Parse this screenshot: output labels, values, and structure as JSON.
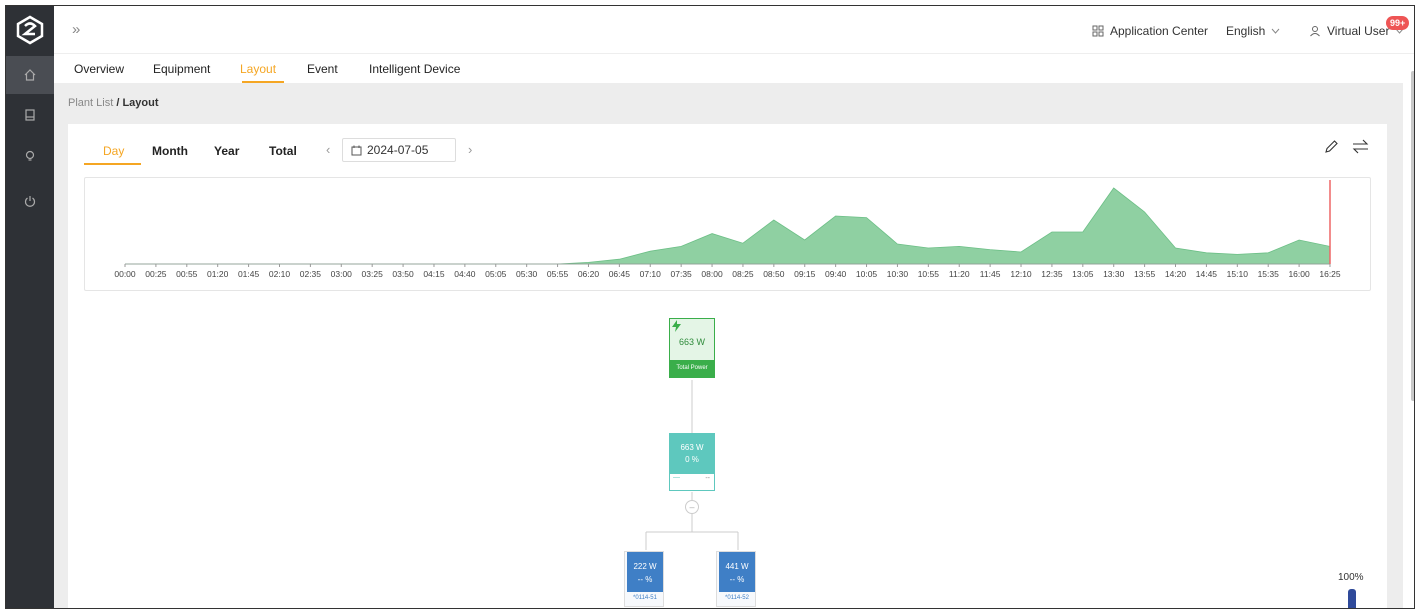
{
  "header": {
    "collapse_icon": "double-chevron-right-icon",
    "app_center": "Application Center",
    "language": "English",
    "user": "Virtual User",
    "notif_count": "99+"
  },
  "tabs": [
    "Overview",
    "Equipment",
    "Layout",
    "Event",
    "Intelligent Device"
  ],
  "active_tab": "Layout",
  "breadcrumb": {
    "parent": "Plant List",
    "sep": "/",
    "current": "Layout"
  },
  "periods": [
    "Day",
    "Month",
    "Year",
    "Total"
  ],
  "active_period": "Day",
  "date": "2024-07-05",
  "colors": {
    "accent": "#f5a623",
    "sidebar": "#2e3136",
    "area": "#8fd0a2",
    "total_power": "#3aae4a",
    "teal": "#5ec8be",
    "blue": "#3f7fc6"
  },
  "chart_data": {
    "type": "area",
    "x": [
      "00:00",
      "00:25",
      "00:55",
      "01:20",
      "01:45",
      "02:10",
      "02:35",
      "03:00",
      "03:25",
      "03:50",
      "04:15",
      "04:40",
      "05:05",
      "05:30",
      "05:55",
      "06:20",
      "06:45",
      "07:10",
      "07:35",
      "08:00",
      "08:25",
      "08:50",
      "09:15",
      "09:40",
      "10:05",
      "10:30",
      "10:55",
      "11:20",
      "11:45",
      "12:10",
      "12:35",
      "13:05",
      "13:30",
      "13:55",
      "14:20",
      "14:45",
      "15:10",
      "15:35",
      "16:00",
      "16:25"
    ],
    "values": [
      0,
      0,
      0,
      0,
      0,
      0,
      0,
      0,
      0,
      0,
      0,
      0,
      0,
      0,
      0,
      0.02,
      0.06,
      0.16,
      0.22,
      0.38,
      0.26,
      0.55,
      0.3,
      0.6,
      0.58,
      0.25,
      0.2,
      0.22,
      0.18,
      0.15,
      0.4,
      0.4,
      0.95,
      0.65,
      0.2,
      0.14,
      0.12,
      0.14,
      0.3,
      0.22
    ],
    "y_unit": "relative",
    "grid": false
  },
  "topology": {
    "total": {
      "value": "663 W",
      "label": "Total Power",
      "icon": "lightning-icon"
    },
    "meter": {
      "value": "663 W",
      "percent": "0 %",
      "sub_left": "—",
      "sub_right": "--"
    },
    "collapse_icon": "minus-circle-icon",
    "inverters": [
      {
        "value": "222 W",
        "percent": "-- %",
        "sn": "*0114-51"
      },
      {
        "value": "441 W",
        "percent": "-- %",
        "sn": "*0114-52"
      }
    ],
    "zoom_label": "100%"
  }
}
